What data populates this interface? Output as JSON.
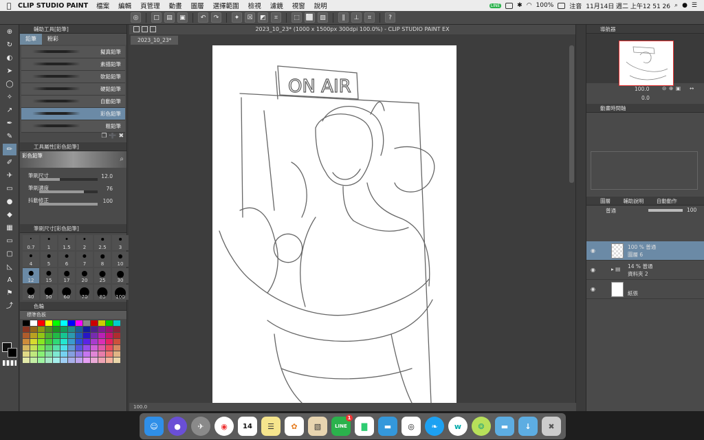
{
  "menubar": {
    "apple": "",
    "app_name": "CLIP STUDIO PAINT",
    "menus": [
      "檔案",
      "編輯",
      "頁管理",
      "動畫",
      "圖層",
      "選擇範圍",
      "檢視",
      "濾鏡",
      "視窗",
      "說明"
    ],
    "status": {
      "line": "LINE",
      "battery": "100%",
      "input": "注音",
      "clock": "11月14日 週二 上午12 51 26"
    }
  },
  "left_panel": {
    "sub_tool_header": "輔助工具[鉛筆]",
    "tabs": [
      "鉛筆",
      "粉彩"
    ],
    "brushes": [
      "擬真鉛筆",
      "素描鉛筆",
      "軟鉛鉛筆",
      "硬鉛鉛筆",
      "自動鉛筆",
      "彩色鉛筆",
      "粗鉛筆"
    ],
    "selected_brush": "彩色鉛筆",
    "tool_property_header": "工具屬性[彩色鉛筆]",
    "tool_name": "彩色鉛筆",
    "props": [
      {
        "label": "筆刷尺寸",
        "value": "12.0",
        "fill": 0.35
      },
      {
        "label": "筆刷濃度",
        "value": "76",
        "fill": 0.76
      },
      {
        "label": "抖動修正",
        "value": "100",
        "fill": 1.0
      }
    ],
    "brush_size_header": "筆刷尺寸[彩色鉛筆]",
    "sizes": [
      "0.7",
      "1",
      "1.5",
      "2",
      "2.5",
      "3",
      "4",
      "5",
      "6",
      "7",
      "8",
      "10",
      "12",
      "15",
      "17",
      "20",
      "25",
      "30",
      "40",
      "50",
      "60",
      "70",
      "80",
      "100"
    ],
    "selected_size": "12",
    "color_header": "色輪",
    "palette_name": "標準色板"
  },
  "canvas": {
    "window_title": "2023_10_23* (1000 x 1500px 300dpi 100.0%) - CLIP STUDIO PAINT EX",
    "doc_tab": "2023_10_23*",
    "zoom": "100.0",
    "sketch_text": "ON AIR"
  },
  "right_panel": {
    "navigator_tab": "導航器",
    "nav_zoom": "100.0",
    "nav_angle": "0.0",
    "anim_tab": "動畫時間軸",
    "layer_tabs": [
      "圖層",
      "輔助說明",
      "自動動作"
    ],
    "blend_mode": "普通",
    "opacity": "100",
    "layers": [
      {
        "line1": "100 % 普通",
        "line2": "圖層 6",
        "selected": true
      },
      {
        "line1": "14 % 普通",
        "line2": "資料夾 2",
        "selected": false
      },
      {
        "line1": "",
        "line2": "紙張",
        "selected": false
      }
    ]
  },
  "dock": {
    "items": [
      "Finder",
      "Siri",
      "Launchpad",
      "Chrome",
      "Calendar",
      "Notes",
      "Photos",
      "Preview",
      "LINE",
      "Numbers",
      "Keynote",
      "Clip Studio",
      "Twitter",
      "Wakelet",
      "Lime",
      "Folder",
      "Downloads",
      "Trash"
    ],
    "calendar_day": "14",
    "line_badge": "1"
  }
}
